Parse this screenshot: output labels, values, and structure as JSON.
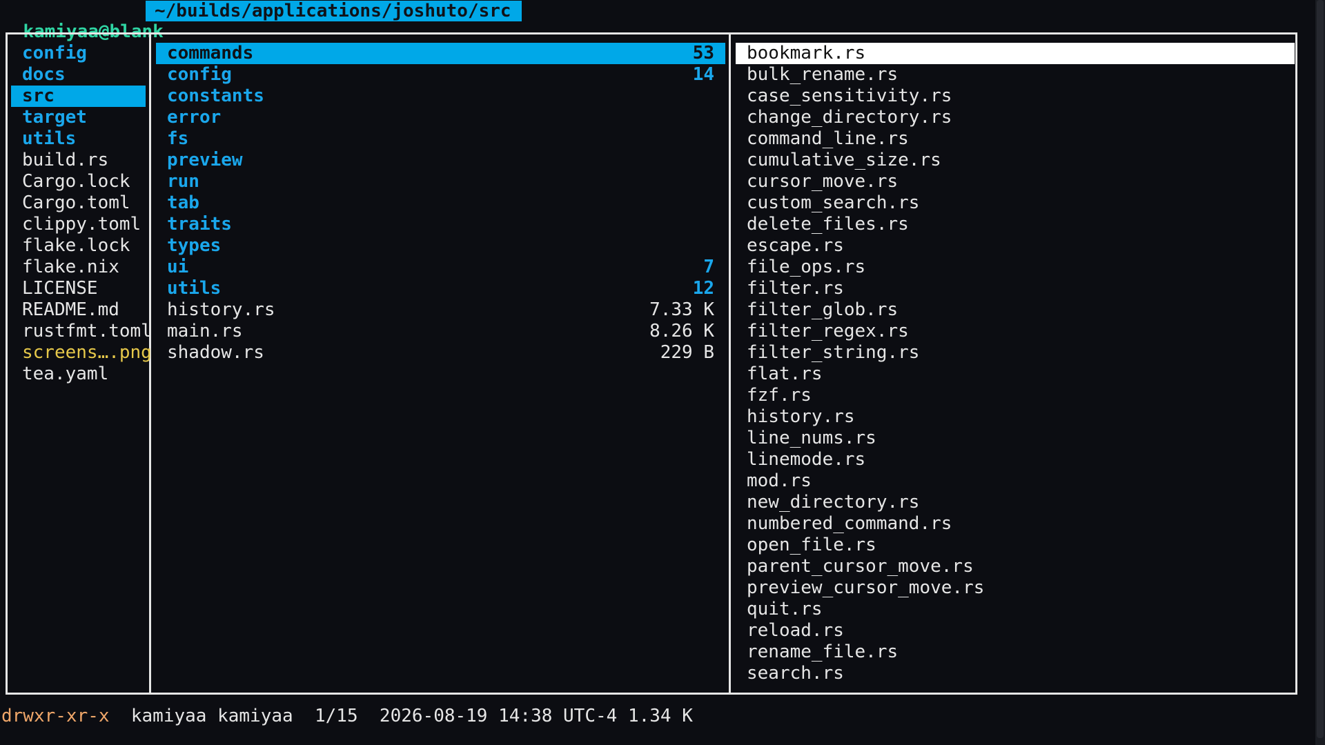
{
  "header": {
    "userhost": "kamiyaa@blank",
    "path": "~/builds/applications/joshuto/src"
  },
  "parent_pane": [
    {
      "name": "config",
      "kind": "dir"
    },
    {
      "name": "docs",
      "kind": "dir"
    },
    {
      "name": "src",
      "kind": "dir",
      "selected": true
    },
    {
      "name": "target",
      "kind": "dir"
    },
    {
      "name": "utils",
      "kind": "dir"
    },
    {
      "name": "build.rs",
      "kind": "file"
    },
    {
      "name": "Cargo.lock",
      "kind": "file"
    },
    {
      "name": "Cargo.toml",
      "kind": "file"
    },
    {
      "name": "clippy.toml",
      "kind": "file"
    },
    {
      "name": "flake.lock",
      "kind": "file"
    },
    {
      "name": "flake.nix",
      "kind": "file"
    },
    {
      "name": "LICENSE",
      "kind": "file"
    },
    {
      "name": "README.md",
      "kind": "file"
    },
    {
      "name": "rustfmt.toml",
      "kind": "file"
    },
    {
      "name": "screens….png",
      "kind": "image"
    },
    {
      "name": "tea.yaml",
      "kind": "file"
    }
  ],
  "current_pane": [
    {
      "name": "commands",
      "size": "53",
      "kind": "dir",
      "selected": true
    },
    {
      "name": "config",
      "size": "14",
      "kind": "dir"
    },
    {
      "name": "constants",
      "size": "",
      "kind": "dir"
    },
    {
      "name": "error",
      "size": "",
      "kind": "dir"
    },
    {
      "name": "fs",
      "size": "",
      "kind": "dir"
    },
    {
      "name": "preview",
      "size": "",
      "kind": "dir"
    },
    {
      "name": "run",
      "size": "",
      "kind": "dir"
    },
    {
      "name": "tab",
      "size": "",
      "kind": "dir"
    },
    {
      "name": "traits",
      "size": "",
      "kind": "dir"
    },
    {
      "name": "types",
      "size": "",
      "kind": "dir"
    },
    {
      "name": "ui",
      "size": "7",
      "kind": "dir"
    },
    {
      "name": "utils",
      "size": "12",
      "kind": "dir"
    },
    {
      "name": "history.rs",
      "size": "7.33 K",
      "kind": "file"
    },
    {
      "name": "main.rs",
      "size": "8.26 K",
      "kind": "file"
    },
    {
      "name": "shadow.rs",
      "size": "229 B",
      "kind": "file"
    }
  ],
  "preview_pane": [
    {
      "name": "bookmark.rs",
      "selected": true
    },
    {
      "name": "bulk_rename.rs"
    },
    {
      "name": "case_sensitivity.rs"
    },
    {
      "name": "change_directory.rs"
    },
    {
      "name": "command_line.rs"
    },
    {
      "name": "cumulative_size.rs"
    },
    {
      "name": "cursor_move.rs"
    },
    {
      "name": "custom_search.rs"
    },
    {
      "name": "delete_files.rs"
    },
    {
      "name": "escape.rs"
    },
    {
      "name": "file_ops.rs"
    },
    {
      "name": "filter.rs"
    },
    {
      "name": "filter_glob.rs"
    },
    {
      "name": "filter_regex.rs"
    },
    {
      "name": "filter_string.rs"
    },
    {
      "name": "flat.rs"
    },
    {
      "name": "fzf.rs"
    },
    {
      "name": "history.rs"
    },
    {
      "name": "line_nums.rs"
    },
    {
      "name": "linemode.rs"
    },
    {
      "name": "mod.rs"
    },
    {
      "name": "new_directory.rs"
    },
    {
      "name": "numbered_command.rs"
    },
    {
      "name": "open_file.rs"
    },
    {
      "name": "parent_cursor_move.rs"
    },
    {
      "name": "preview_cursor_move.rs"
    },
    {
      "name": "quit.rs"
    },
    {
      "name": "reload.rs"
    },
    {
      "name": "rename_file.rs"
    },
    {
      "name": "search.rs"
    }
  ],
  "status": {
    "permissions": "drwxr-xr-x",
    "owner": "kamiyaa",
    "group": "kamiyaa",
    "position": "1/15",
    "modified": "2026-08-19 14:38 UTC-4",
    "size": "1.34 K"
  },
  "colors": {
    "background": "#0c0d12",
    "directory": "#1aa7ec",
    "file": "#e6e6e6",
    "image": "#e6c84a",
    "selection": "#00a8e8",
    "userhost": "#2fd5a3",
    "permissions": "#f0a76a"
  }
}
